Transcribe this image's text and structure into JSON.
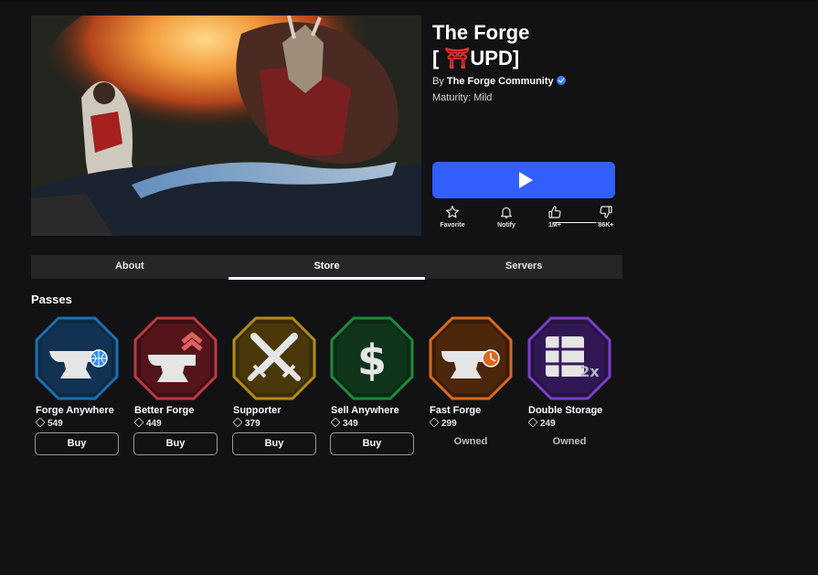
{
  "game": {
    "title_line1": "The Forge",
    "title_torii": "⛩",
    "title_line2_open": "[ ",
    "title_line2_rest": "UPD]",
    "by_label": "By ",
    "creator": "The Forge Community",
    "maturity": "Maturity: Mild",
    "thumbnail_icon": "forge-key-art"
  },
  "play_button": {
    "icon": "play-icon",
    "color": "#335fff"
  },
  "actions": {
    "favorite_label": "Favorite",
    "notify_label": "Notify",
    "likes": "1M+",
    "dislikes": "86K+",
    "like_ratio": 0.92
  },
  "tabs": [
    {
      "label": "About",
      "active": false
    },
    {
      "label": "Store",
      "active": true
    },
    {
      "label": "Servers",
      "active": false
    }
  ],
  "store": {
    "section_title": "Passes",
    "passes": [
      {
        "name": "Forge Anywhere",
        "price": "549",
        "action": "Buy",
        "owned": false,
        "color": "#1c6fb0",
        "icon": "anvil-globe-icon"
      },
      {
        "name": "Better Forge",
        "price": "449",
        "action": "Buy",
        "owned": false,
        "color": "#c0383f",
        "icon": "anvil-upgrade-icon"
      },
      {
        "name": "Supporter",
        "price": "379",
        "action": "Buy",
        "owned": false,
        "color": "#b38a1a",
        "icon": "crossed-swords-icon"
      },
      {
        "name": "Sell Anywhere",
        "price": "349",
        "action": "Buy",
        "owned": false,
        "color": "#1f8a3a",
        "icon": "dollar-icon"
      },
      {
        "name": "Fast Forge",
        "price": "299",
        "action": "Owned",
        "owned": true,
        "color": "#d86a1e",
        "icon": "anvil-clock-icon"
      },
      {
        "name": "Double Storage",
        "price": "249",
        "action": "Owned",
        "owned": true,
        "color": "#7a3fc6",
        "icon": "storage-2x-icon"
      }
    ]
  }
}
